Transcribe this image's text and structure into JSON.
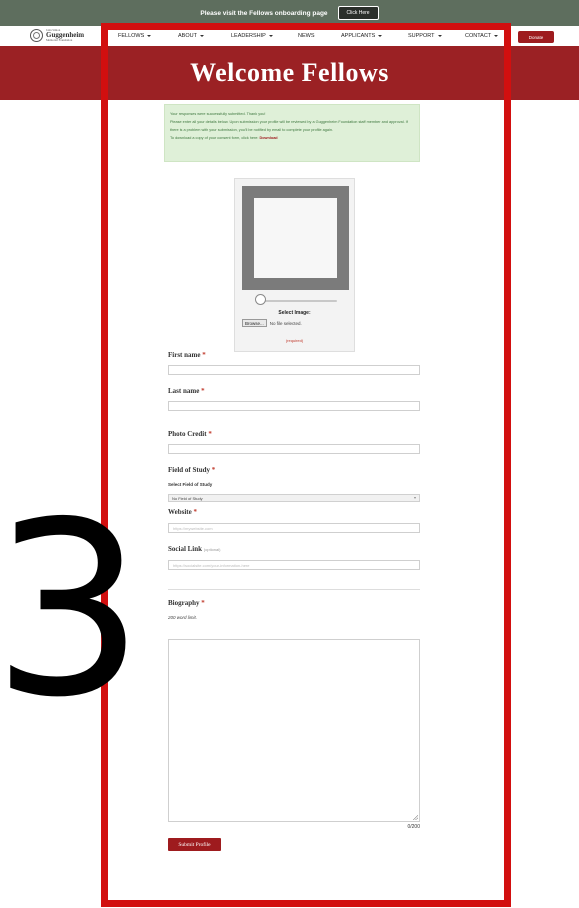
{
  "announcement": {
    "text": "Please visit the Fellows onboarding page",
    "button": "Click Here"
  },
  "logo": {
    "line1": "John Simon",
    "line2": "Guggenheim",
    "line3": "Memorial Foundation"
  },
  "nav": {
    "items": [
      {
        "label": "FELLOWS",
        "caret": true
      },
      {
        "label": "ABOUT",
        "caret": true
      },
      {
        "label": "LEADERSHIP",
        "caret": true
      },
      {
        "label": "NEWS",
        "caret": false
      },
      {
        "label": "APPLICANTS",
        "caret": true
      },
      {
        "label": "SUPPORT",
        "caret": true
      },
      {
        "label": "CONTACT",
        "caret": true
      }
    ],
    "donate": "Donate"
  },
  "hero": {
    "title": "Welcome Fellows"
  },
  "success": {
    "line1": "Your responses were successfully submitted. Thank you!",
    "line2": "Please enter all your details below. Upon submission your profile will be reviewed by a Guggenheim Foundation staff member and approval. If there is a problem with your submission, you'll be notified by email to complete your profile again.",
    "line3_prefix": "To download a copy of your consent form, click here: ",
    "download_link": "Download"
  },
  "photo": {
    "select_label": "Select Image:",
    "browse": "Browse...",
    "no_file": "No file selected.",
    "required": "(required)",
    "slider_value": 0
  },
  "form": {
    "first_name": "First name",
    "last_name": "Last name",
    "photo_credit": "Photo Credit",
    "field_of_study": "Field of Study",
    "field_of_study_sub": "Select Field of Study",
    "field_of_study_value": "No Field of Study",
    "website": "Website",
    "website_placeholder": "https://mywebsite.com",
    "social_link": "Social Link",
    "optional": "(optional)",
    "social_placeholder": "https://socialsite.com/your-information-here",
    "biography": "Biography",
    "biography_note": "200 word limit.",
    "word_count": "0/200",
    "required_mark": "*",
    "submit": "Submit Profile"
  },
  "annotation": {
    "number": "3"
  },
  "colors": {
    "brand_red": "#9b2124",
    "announce_bg": "#5e6e5e",
    "success_bg": "#dff0d8",
    "annotation_red": "#d20f0f"
  }
}
